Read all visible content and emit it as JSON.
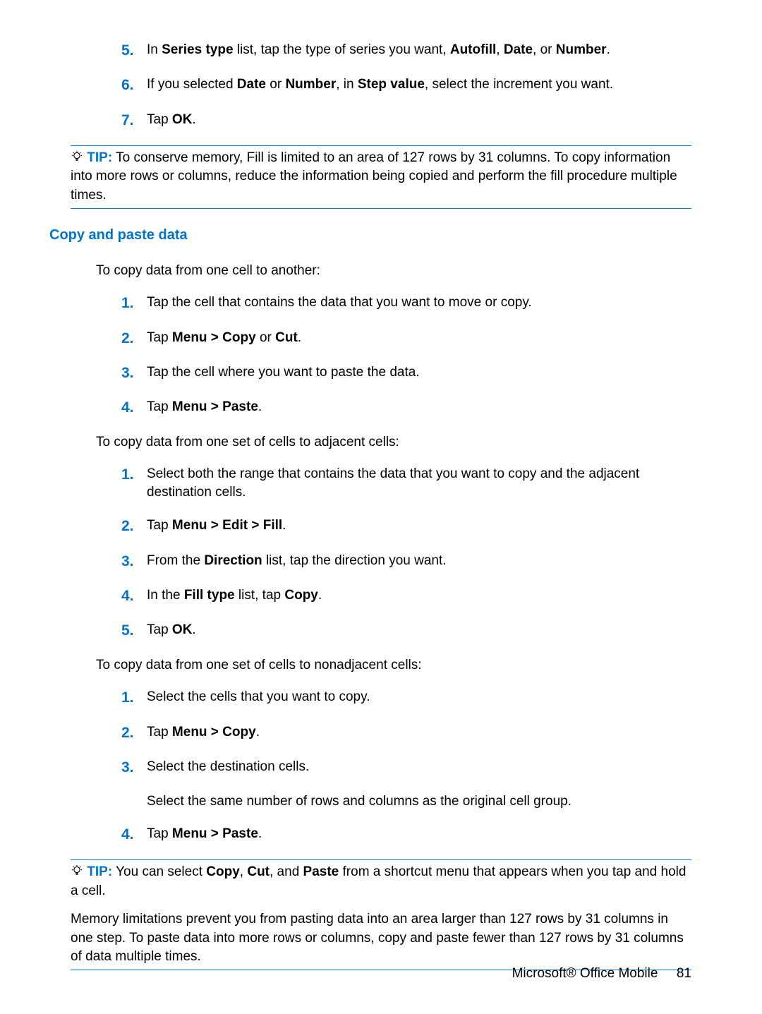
{
  "list1": [
    {
      "num": "5.",
      "parts": [
        "In ",
        {
          "b": "Series type"
        },
        " list, tap the type of series you want, ",
        {
          "b": "Autofill"
        },
        ", ",
        {
          "b": "Date"
        },
        ", or ",
        {
          "b": "Number"
        },
        "."
      ]
    },
    {
      "num": "6.",
      "parts": [
        "If you selected ",
        {
          "b": "Date"
        },
        " or ",
        {
          "b": "Number"
        },
        ", in ",
        {
          "b": "Step value"
        },
        ", select the increment you want."
      ]
    },
    {
      "num": "7.",
      "parts": [
        "Tap ",
        {
          "b": "OK"
        },
        "."
      ]
    }
  ],
  "tip1": {
    "label": "TIP:",
    "text": "To conserve memory, Fill is limited to an area of 127 rows by 31 columns. To copy information into more rows or columns, reduce the information being copied and perform the fill procedure multiple times."
  },
  "heading": "Copy and paste data",
  "para1": "To copy data from one cell to another:",
  "list2": [
    {
      "num": "1.",
      "parts": [
        "Tap the cell that contains the data that you want to move or copy."
      ]
    },
    {
      "num": "2.",
      "parts": [
        "Tap ",
        {
          "b": "Menu > Copy"
        },
        " or ",
        {
          "b": "Cut"
        },
        "."
      ]
    },
    {
      "num": "3.",
      "parts": [
        "Tap the cell where you want to paste the data."
      ]
    },
    {
      "num": "4.",
      "parts": [
        "Tap ",
        {
          "b": "Menu > Paste"
        },
        "."
      ]
    }
  ],
  "para2": "To copy data from one set of cells to adjacent cells:",
  "list3": [
    {
      "num": "1.",
      "parts": [
        "Select both the range that contains the data that you want to copy and the adjacent destination cells."
      ]
    },
    {
      "num": "2.",
      "parts": [
        "Tap ",
        {
          "b": "Menu > Edit > Fill"
        },
        "."
      ]
    },
    {
      "num": "3.",
      "parts": [
        "From the ",
        {
          "b": "Direction"
        },
        " list, tap the direction you want."
      ]
    },
    {
      "num": "4.",
      "parts": [
        "In the ",
        {
          "b": "Fill type"
        },
        " list, tap ",
        {
          "b": "Copy"
        },
        "."
      ]
    },
    {
      "num": "5.",
      "parts": [
        "Tap ",
        {
          "b": "OK"
        },
        "."
      ]
    }
  ],
  "para3": "To copy data from one set of cells to nonadjacent cells:",
  "list4": [
    {
      "num": "1.",
      "parts": [
        "Select the cells that you want to copy."
      ]
    },
    {
      "num": "2.",
      "parts": [
        "Tap ",
        {
          "b": "Menu > Copy"
        },
        "."
      ]
    },
    {
      "num": "3.",
      "parts": [
        "Select the destination cells."
      ]
    }
  ],
  "para4": "Select the same number of rows and columns as the original cell group.",
  "list5": [
    {
      "num": "4.",
      "parts": [
        "Tap ",
        {
          "b": "Menu > Paste"
        },
        "."
      ]
    }
  ],
  "tip2": {
    "label": "TIP:",
    "parts": [
      "You can select ",
      {
        "b": "Copy"
      },
      ", ",
      {
        "b": "Cut"
      },
      ", and ",
      {
        "b": "Paste"
      },
      " from a shortcut menu that appears when you tap and hold a cell."
    ],
    "extra": "Memory limitations prevent you from pasting data into an area larger than 127 rows by 31 columns in one step. To paste data into more rows or columns, copy and paste fewer than 127 rows by 31 columns of data multiple times."
  },
  "footer": {
    "title": "Microsoft® Office Mobile",
    "page": "81"
  }
}
